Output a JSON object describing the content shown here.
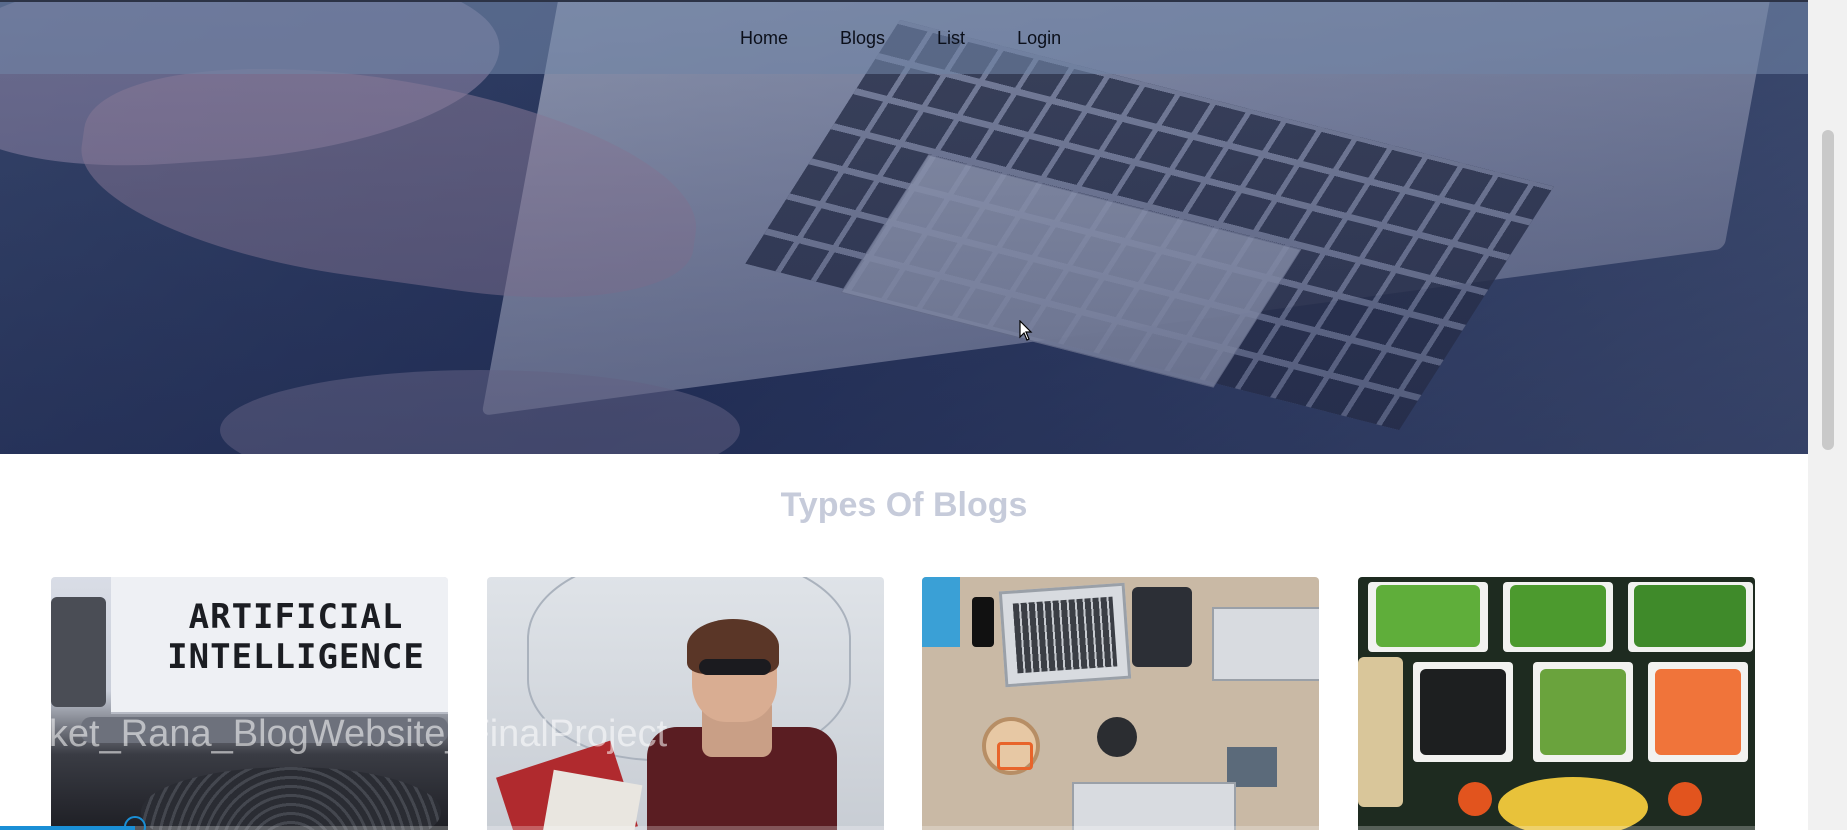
{
  "nav": {
    "items": [
      {
        "label": "Home"
      },
      {
        "label": "Blogs"
      },
      {
        "label": "List"
      },
      {
        "label": "Login"
      }
    ]
  },
  "section": {
    "title": "Types Of Blogs"
  },
  "cards": [
    {
      "image_text": "ARTIFICIAL INTELLIGENCE",
      "icon": "typewriter-image"
    },
    {
      "icon": "fashion-image"
    },
    {
      "icon": "workspace-desk-image"
    },
    {
      "icon": "vegetables-food-image"
    }
  ],
  "video": {
    "title": "Aniket_Rana_BlogWebsite_FinalProject",
    "progress": 0.073
  },
  "colors": {
    "nav_bg": "#7084a5",
    "section_title": "#c6cbda",
    "progress_accent": "#1a8fd6"
  }
}
